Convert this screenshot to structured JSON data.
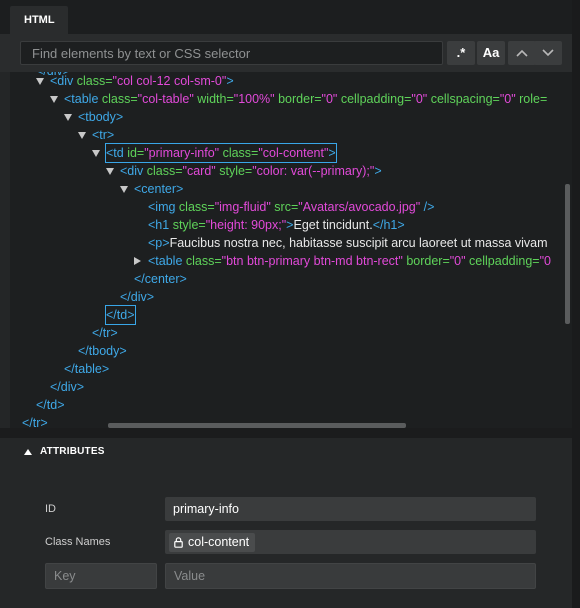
{
  "tabs": {
    "active": "HTML"
  },
  "search": {
    "placeholder": "Find elements by text or CSS selector",
    "regex_label": ".*",
    "case_label": "Aa",
    "prev_icon": "chevron-up-icon",
    "next_icon": "chevron-down-icon"
  },
  "tree": {
    "lines": [
      {
        "id": "l0",
        "parts": [
          [
            "tg",
            "</"
          ],
          [
            "tg",
            "div"
          ],
          [
            "tg",
            ">"
          ]
        ]
      },
      {
        "id": "l1",
        "parts": [
          [
            "tg",
            "<div "
          ],
          [
            "an",
            "class="
          ],
          [
            "av",
            "\"col col-12 col-sm-0\""
          ],
          [
            "tg",
            ">"
          ]
        ]
      },
      {
        "id": "l2",
        "parts": [
          [
            "tg",
            "<table "
          ],
          [
            "an",
            "class="
          ],
          [
            "av",
            "\"col-table\""
          ],
          [
            "an",
            " width="
          ],
          [
            "av",
            "\"100%\""
          ],
          [
            "an",
            " border="
          ],
          [
            "av",
            "\"0\""
          ],
          [
            "an",
            " cellpadding="
          ],
          [
            "av",
            "\"0\""
          ],
          [
            "an",
            " cellspacing="
          ],
          [
            "av",
            "\"0\""
          ],
          [
            "an",
            " role="
          ]
        ]
      },
      {
        "id": "l3",
        "parts": [
          [
            "tg",
            "<tbody>"
          ]
        ]
      },
      {
        "id": "l4",
        "parts": [
          [
            "tg",
            "<tr>"
          ]
        ]
      },
      {
        "id": "l5",
        "parts": [
          [
            "tg",
            "<td "
          ],
          [
            "an",
            "id="
          ],
          [
            "av",
            "\"primary-info\""
          ],
          [
            "an",
            " class="
          ],
          [
            "av",
            "\"col-content\""
          ],
          [
            "tg",
            ">"
          ]
        ]
      },
      {
        "id": "l6",
        "parts": [
          [
            "tg",
            "<div "
          ],
          [
            "an",
            "class="
          ],
          [
            "av",
            "\"card\""
          ],
          [
            "an",
            " style="
          ],
          [
            "av",
            "\"color: var(--primary);\""
          ],
          [
            "tg",
            ">"
          ]
        ]
      },
      {
        "id": "l7",
        "parts": [
          [
            "tg",
            "<center>"
          ]
        ]
      },
      {
        "id": "l8",
        "parts": [
          [
            "tg",
            "<img "
          ],
          [
            "an",
            "class="
          ],
          [
            "av",
            "\"img-fluid\""
          ],
          [
            "an",
            " src="
          ],
          [
            "av",
            "\"Avatars/avocado.jpg\""
          ],
          [
            "tg",
            " />"
          ]
        ]
      },
      {
        "id": "l9",
        "parts": [
          [
            "tg",
            "<h1 "
          ],
          [
            "an",
            "style="
          ],
          [
            "av",
            "\"height: 90px;\""
          ],
          [
            "tg",
            ">"
          ],
          [
            "tx",
            "Eget tincidunt."
          ],
          [
            "tg",
            "</h1>"
          ]
        ]
      },
      {
        "id": "l10",
        "parts": [
          [
            "tg",
            "<p>"
          ],
          [
            "tx",
            "Faucibus nostra nec, habitasse suscipit arcu laoreet ut massa vivam"
          ]
        ]
      },
      {
        "id": "l11",
        "parts": [
          [
            "tg",
            "<table "
          ],
          [
            "an",
            "class="
          ],
          [
            "av",
            "\"btn btn-primary btn-md btn-rect\""
          ],
          [
            "an",
            " border="
          ],
          [
            "av",
            "\"0\""
          ],
          [
            "an",
            " cellpadding="
          ],
          [
            "av",
            "\"0"
          ]
        ]
      },
      {
        "id": "l12",
        "parts": [
          [
            "tg",
            "</center>"
          ]
        ]
      },
      {
        "id": "l13",
        "parts": [
          [
            "tg",
            "</div>"
          ]
        ]
      },
      {
        "id": "l14",
        "parts": [
          [
            "tg",
            "</td>"
          ]
        ]
      },
      {
        "id": "l15",
        "parts": [
          [
            "tg",
            "</tr>"
          ]
        ]
      },
      {
        "id": "l16",
        "parts": [
          [
            "tg",
            "</tbody>"
          ]
        ]
      },
      {
        "id": "l17",
        "parts": [
          [
            "tg",
            "</table>"
          ]
        ]
      },
      {
        "id": "l18",
        "parts": [
          [
            "tg",
            "</div>"
          ]
        ]
      },
      {
        "id": "l19",
        "parts": [
          [
            "tg",
            "</td>"
          ]
        ]
      },
      {
        "id": "l20",
        "parts": [
          [
            "tg",
            "</tr>"
          ]
        ]
      }
    ]
  },
  "attributes": {
    "title": "ATTRIBUTES",
    "id_label": "ID",
    "id_value": "primary-info",
    "class_label": "Class Names",
    "class_chip": "col-content",
    "key_placeholder": "Key",
    "value_placeholder": "Value"
  },
  "colors": {
    "tag": "#3fa9e8",
    "attr_name": "#5fd35a",
    "attr_value": "#e24ad9",
    "selection_outline": "#39a6e8"
  }
}
